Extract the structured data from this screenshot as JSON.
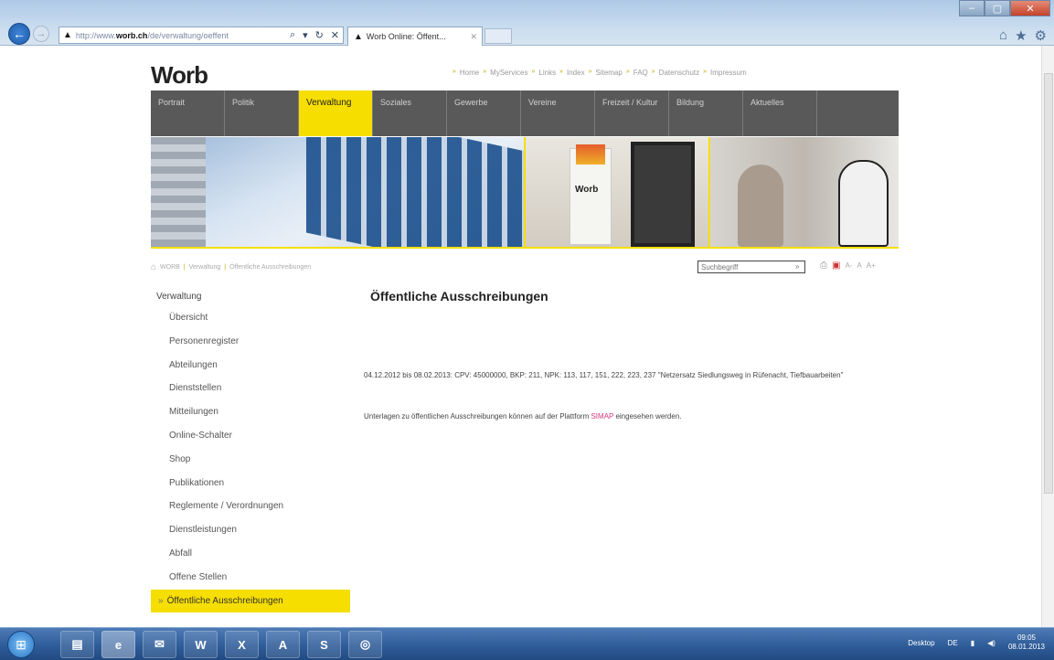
{
  "browser": {
    "url_domain": "worb.ch",
    "url_prefix": "http://www.",
    "url_path": "/de/verwaltung/oeffent",
    "tab_title": "Worb Online: Öffent...",
    "icons": [
      "back-icon",
      "forward-icon",
      "search-icon",
      "refresh-icon",
      "stop-icon",
      "home-icon",
      "star-icon",
      "gear-icon"
    ]
  },
  "site": {
    "logo": "Worb",
    "top_links": [
      "Home",
      "MyServices",
      "Links",
      "Index",
      "Sitemap",
      "FAQ",
      "Datenschutz",
      "Impressum"
    ],
    "nav": [
      {
        "label": "Portrait",
        "active": false
      },
      {
        "label": "Politik",
        "active": false
      },
      {
        "label": "Verwaltung",
        "active": true
      },
      {
        "label": "Soziales",
        "active": false
      },
      {
        "label": "Gewerbe",
        "active": false
      },
      {
        "label": "Vereine",
        "active": false
      },
      {
        "label": "Freizeit / Kultur",
        "active": false
      },
      {
        "label": "Bildung",
        "active": false
      },
      {
        "label": "Aktuelles",
        "active": false
      }
    ],
    "banner_logo": "Worb",
    "breadcrumb": [
      "WORB",
      "Verwaltung",
      "Öffentliche Ausschreibungen"
    ],
    "search_placeholder": "Suchbegriff",
    "font_sizes": [
      "A-",
      "A",
      "A+"
    ]
  },
  "sidebar": {
    "heading": "Verwaltung",
    "items": [
      {
        "label": "Übersicht",
        "active": false
      },
      {
        "label": "Personenregister",
        "active": false
      },
      {
        "label": "Abteilungen",
        "active": false
      },
      {
        "label": "Dienststellen",
        "active": false
      },
      {
        "label": "Mitteilungen",
        "active": false
      },
      {
        "label": "Online-Schalter",
        "active": false
      },
      {
        "label": "Shop",
        "active": false
      },
      {
        "label": "Publikationen",
        "active": false
      },
      {
        "label": "Reglemente / Verordnungen",
        "active": false
      },
      {
        "label": "Dienstleistungen",
        "active": false
      },
      {
        "label": "Abfall",
        "active": false
      },
      {
        "label": "Offene Stellen",
        "active": false
      },
      {
        "label": "Öffentliche Ausschreibungen",
        "active": true
      }
    ]
  },
  "content": {
    "title": "Öffentliche Ausschreibungen",
    "paragraph": "04.12.2012 bis 08.02.2013: CPV: 45000000, BKP: 211, NPK: 113, 117, 151, 222, 223, 237 \"Netzersatz Siedlungsweg in Rüfenacht, Tiefbauarbeiten\"",
    "note_before": "Unterlagen zu öffentlichen Ausschreibungen können auf der Plattform ",
    "note_link": "SIMAP",
    "note_after": " eingesehen werden."
  },
  "taskbar": {
    "apps": [
      "Explorer",
      "Internet Explorer",
      "Outlook",
      "Word",
      "Excel",
      "Access",
      "Skype",
      "Lifesaver"
    ],
    "desktop_label": "Desktop",
    "language": "DE",
    "time": "09:05",
    "date": "08.01.2013"
  },
  "colors": {
    "accent_yellow": "#f6de00",
    "nav_gray": "#595959",
    "link_pink": "#d4387c"
  }
}
